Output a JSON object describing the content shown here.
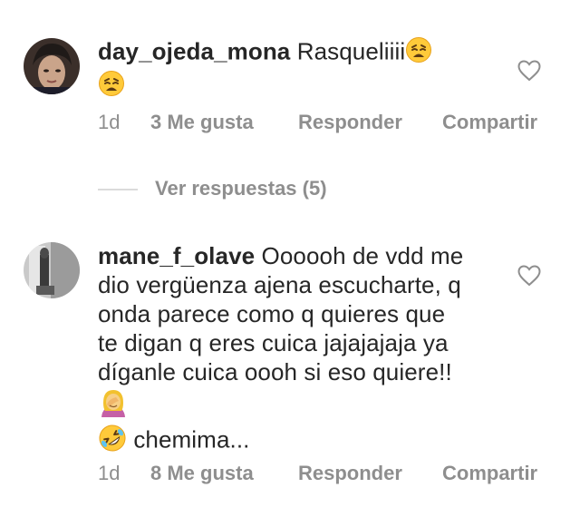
{
  "comments": [
    {
      "username": "day_ojeda_mona",
      "text": "Rasqueliiii",
      "time": "1d",
      "likes": "3 Me gusta",
      "reply_label": "Responder",
      "share_label": "Compartir"
    },
    {
      "username": "mane_f_olave",
      "text": "Oooooh de vdd me dio vergüenza ajena escucharte, q onda parece como q quieres que te digan q eres cuica jajajajaja ya díganle cuica oooh si eso quiere!!",
      "text_after_emoji": "chemima...",
      "time": "1d",
      "likes": "8 Me gusta",
      "reply_label": "Responder",
      "share_label": "Compartir"
    }
  ],
  "view_replies": "Ver respuestas (5)",
  "icons": {
    "like": "heart-outline-icon",
    "emoji_1": "weary-face-emoji",
    "emoji_2": "woman-facepalming-emoji",
    "emoji_3": "rolling-on-floor-laughing-emoji"
  },
  "colors": {
    "text": "#262626",
    "secondary": "#8e8e8e",
    "divider": "#dbdbdb"
  }
}
